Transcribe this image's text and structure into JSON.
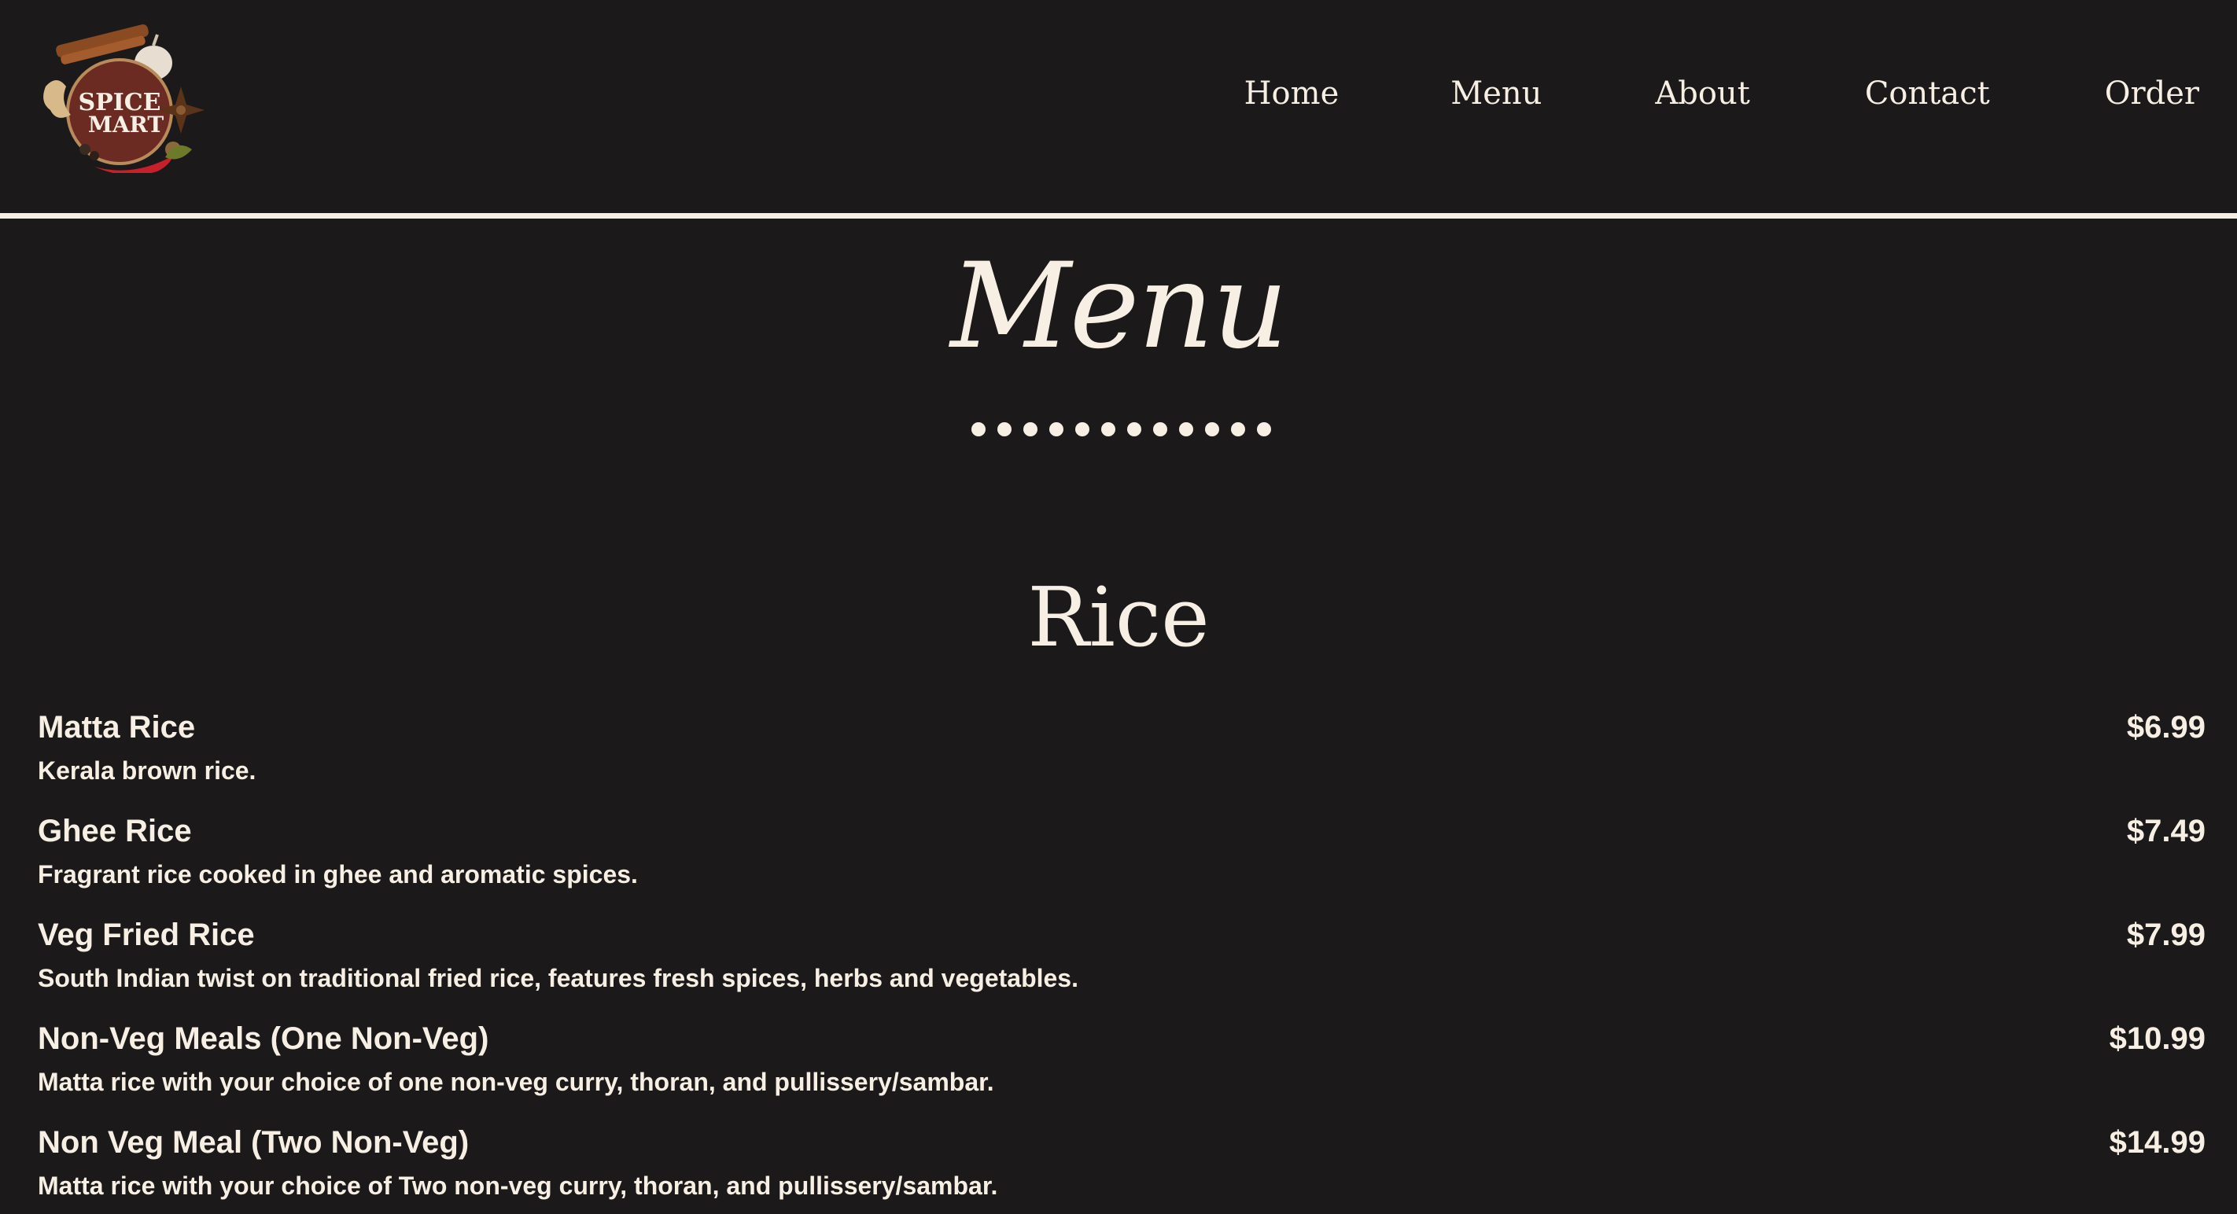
{
  "header": {
    "logo_text_line1": "SPICE",
    "logo_text_line2": "MART",
    "nav": [
      {
        "label": "Home"
      },
      {
        "label": "Menu"
      },
      {
        "label": "About"
      },
      {
        "label": "Contact"
      },
      {
        "label": "Order"
      }
    ]
  },
  "page": {
    "title": "Menu"
  },
  "section": {
    "title": "Rice",
    "items": [
      {
        "name": "Matta Rice",
        "desc": "Kerala brown rice.",
        "price": "$6.99"
      },
      {
        "name": "Ghee Rice",
        "desc": "Fragrant rice cooked in ghee and aromatic spices.",
        "price": "$7.49"
      },
      {
        "name": "Veg Fried Rice",
        "desc": "South Indian twist on traditional fried rice, features fresh spices, herbs and vegetables.",
        "price": "$7.99"
      },
      {
        "name": "Non-Veg Meals (One Non-Veg)",
        "desc": "Matta rice with your choice of one non-veg curry, thoran, and pullissery/sambar.",
        "price": "$10.99"
      },
      {
        "name": "Non Veg Meal (Two Non-Veg)",
        "desc": "Matta rice with your choice of Two non-veg curry, thoran, and pullissery/sambar.",
        "price": "$14.99"
      }
    ]
  },
  "colors": {
    "background": "#1b191a",
    "text": "#f7efe3",
    "logo_badge": "#6b2a22",
    "chili": "#c8202a"
  }
}
